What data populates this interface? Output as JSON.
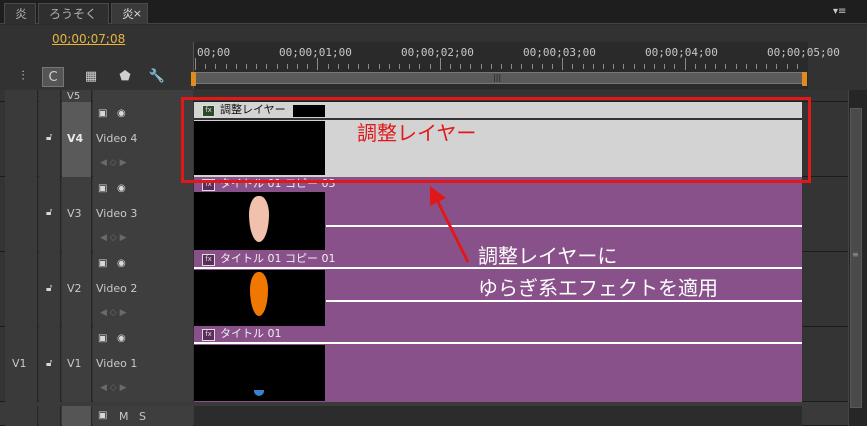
{
  "tabs": [
    {
      "label": "炎"
    },
    {
      "label": "ろうそく"
    },
    {
      "label": "炎",
      "close": "×"
    }
  ],
  "panel_menu": "▾≡",
  "timecode": "00;00;07;08",
  "ruler": {
    "labels": [
      "00;00",
      "00;00;01;00",
      "00;00;02;00",
      "00;00;03;00",
      "00;00;04;00",
      "00;00;05;00"
    ],
    "grip": "|||"
  },
  "tracks": [
    {
      "id": "V5",
      "name": ""
    },
    {
      "id": "V4",
      "name": "Video 4",
      "clip": "調整レイヤー"
    },
    {
      "id": "V3",
      "name": "Video 3",
      "clip": "タイトル 01 コピー 03"
    },
    {
      "id": "V2",
      "name": "Video 2",
      "clip": "タイトル 01 コピー 01"
    },
    {
      "id": "V1",
      "name": "Video 1",
      "clip": "タイトル 01",
      "source": "V1"
    }
  ],
  "audio_header": {
    "m": "M",
    "s": "S"
  },
  "icons": {
    "lock": "lock-icon",
    "eye": "eye-icon",
    "film": "film-icon",
    "fx": "fx"
  },
  "annotations": {
    "box_label": "調整レイヤー",
    "note_line1": "調整レイヤーに",
    "note_line2": "ゆらぎ系エフェクトを適用"
  },
  "colors": {
    "accent": "#e8b441",
    "annotation_red": "#e01818",
    "clip_purple": "#89518a",
    "adjustment_layer": "#d3d3d3"
  }
}
